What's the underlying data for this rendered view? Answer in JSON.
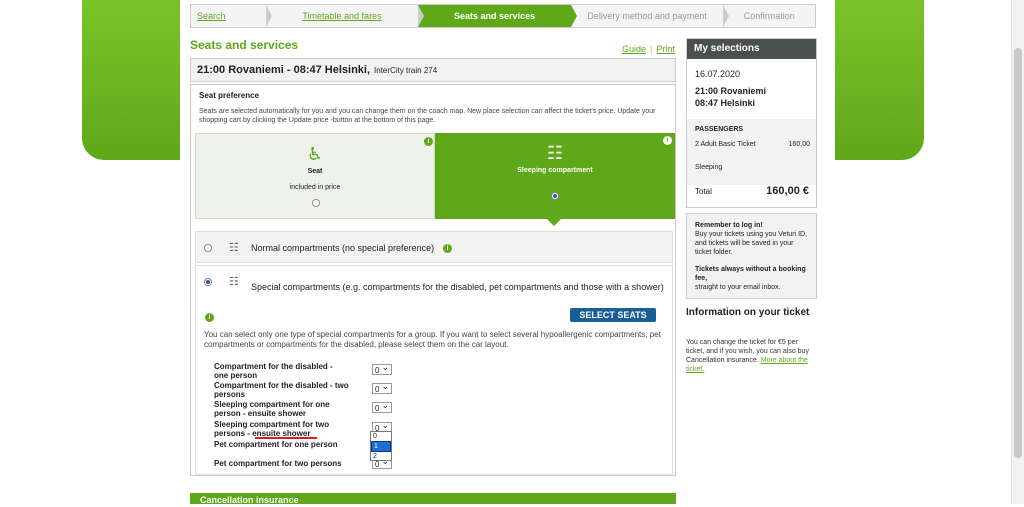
{
  "steps": [
    "Search",
    "Timetable and fares",
    "Seats and services",
    "Delivery method and payment",
    "Confirmation"
  ],
  "page_title": "Seats and services",
  "links": {
    "guide": "Guide",
    "print": "Print"
  },
  "trip": {
    "route": "21:00 Rovaniemi  -  08:47 Helsinki,",
    "train": "InterCity train 274"
  },
  "seat_pref": {
    "heading": "Seat preference",
    "text": "Seats are selected automatically for you and you can change them on the coach map. New place selection can affect the ticket's price. Update your shopping cart by clicking the Update price -button at the bottom of this page.",
    "seat_label": "Seat",
    "seat_sub": "included in price",
    "sleep_label": "Sleeping compartment",
    "info_glyph": "i"
  },
  "compartments": {
    "normal": "Normal compartments (no special preference)",
    "special": "Special compartments (e.g. compartments for the disabled, pet compartments and those with a shower)",
    "select_seats": "SELECT SEATS",
    "desc": "You can select only one type of special compartments for a group. If you want to select several hypoallergenic compartments, pet compartments or compartments for the disabled, please select them on the car layout.",
    "fields": [
      {
        "label": "Compartment for the disabled - one person",
        "value": "0"
      },
      {
        "label": "Compartment for the disabled - two persons",
        "value": "0"
      },
      {
        "label": "Sleeping compartment for one person - ensuite shower",
        "value": "0"
      },
      {
        "label": "Sleeping compartment for two persons - ensuite shower",
        "value": "0"
      },
      {
        "label": "Pet compartment for one person",
        "value": ""
      },
      {
        "label": "Pet compartment for two persons",
        "value": "0"
      }
    ],
    "dropdown_options": [
      "0",
      "1",
      "2"
    ]
  },
  "cancellation": "Cancellation insurance",
  "my_selections": {
    "title": "My selections",
    "date": "16.07.2020",
    "dep": "21:00 Rovaniemi",
    "arr": "08:47 Helsinki",
    "passengers_label": "PASSENGERS",
    "ticket": "2 Adult Basic Ticket",
    "ticket_price": "160,00",
    "sleeping": "Sleeping",
    "total_label": "Total",
    "total_value": "160,00 €"
  },
  "login": {
    "title": "Remember to log in!",
    "text": "Buy your tickets using you Veturi ID, and tickets will be saved in your ticket folder.",
    "title2": "Tickets always without a booking fee,",
    "text2": "straight to your email inbox."
  },
  "info": {
    "title": "Information on your ticket",
    "text": "You can change the ticket for €5 per ticket, and if you wish, you can also buy Cancellation insurance.",
    "link": "More about the ticket."
  },
  "colors": {
    "brand_green": "#5fa81a",
    "button_blue": "#1a5e96",
    "panel_dark": "#4a5052"
  }
}
